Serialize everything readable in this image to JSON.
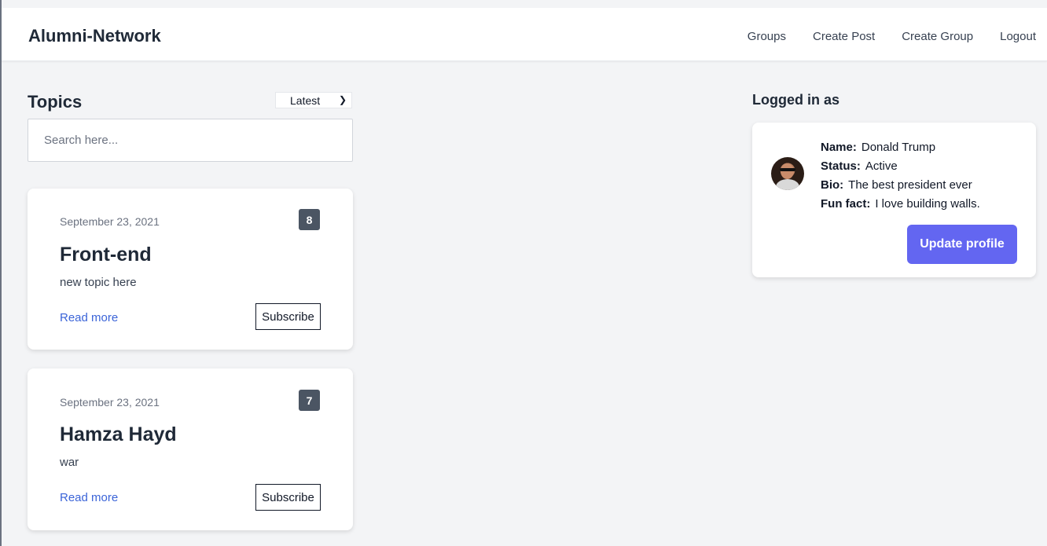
{
  "nav": {
    "brand": "Alumni-Network",
    "links": [
      "Groups",
      "Create Post",
      "Create Group",
      "Logout"
    ]
  },
  "topics": {
    "title": "Topics",
    "sort_selected": "Latest",
    "search_placeholder": "Search here...",
    "cards": [
      {
        "date": "September 23, 2021",
        "count": "8",
        "title": "Front-end",
        "description": "new topic here",
        "read_more": "Read more",
        "subscribe": "Subscribe"
      },
      {
        "date": "September 23, 2021",
        "count": "7",
        "title": "Hamza Hayd",
        "description": "war",
        "read_more": "Read more",
        "subscribe": "Subscribe"
      }
    ]
  },
  "profile": {
    "title": "Logged in as",
    "name_label": "Name:",
    "name": "Donald Trump",
    "status_label": "Status:",
    "status": "Active",
    "bio_label": "Bio:",
    "bio": "The best president ever",
    "funfact_label": "Fun fact:",
    "funfact": "I love building walls.",
    "update_button": "Update profile"
  },
  "colors": {
    "background": "#f3f4f6",
    "accent": "#6366f1",
    "link": "#3b64d8",
    "badge": "#4b5563"
  }
}
